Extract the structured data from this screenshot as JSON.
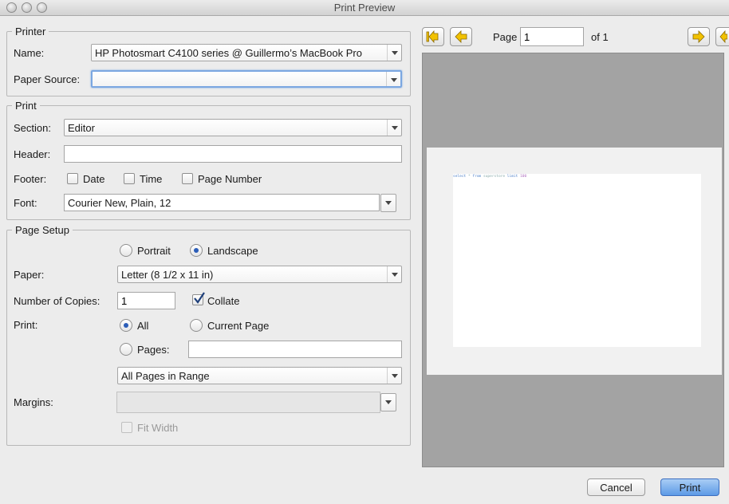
{
  "window": {
    "title": "Print Preview"
  },
  "printer": {
    "legend": "Printer",
    "name_label": "Name:",
    "name_value": "HP Photosmart C4100 series @ Guillermo’s MacBook Pro",
    "source_label": "Paper Source:",
    "source_value": ""
  },
  "print": {
    "legend": "Print",
    "section_label": "Section:",
    "section_value": "Editor",
    "header_label": "Header:",
    "header_value": "",
    "footer_label": "Footer:",
    "footer_date": "Date",
    "footer_time": "Time",
    "footer_page_number": "Page Number",
    "font_label": "Font:",
    "font_value": "Courier New, Plain, 12"
  },
  "page_setup": {
    "legend": "Page Setup",
    "portrait": "Portrait",
    "landscape": "Landscape",
    "orientation_selected": "Landscape",
    "paper_label": "Paper:",
    "paper_value": "Letter (8 1/2 x 11 in)",
    "copies_label": "Number of Copies:",
    "copies_value": "1",
    "collate": "Collate",
    "collate_checked": true,
    "print_label": "Print:",
    "all": "All",
    "current_page": "Current Page",
    "pages": "Pages:",
    "pages_value": "",
    "range_value": "All Pages in Range",
    "margins_label": "Margins:",
    "margins_value": "",
    "fit_width": "Fit Width"
  },
  "preview": {
    "page_label": "Page",
    "page_value": "1",
    "of_label": "of 1",
    "code": {
      "select": "select",
      "star": "*",
      "from": "from",
      "table": "superstore",
      "limit": "limit",
      "n": "100"
    }
  },
  "footer": {
    "cancel": "Cancel",
    "print": "Print"
  },
  "colors": {
    "accent": "#5c9ae6",
    "preview_bg": "#a3a3a3"
  },
  "icons": [
    "first-page-icon",
    "prev-page-icon",
    "next-page-icon",
    "last-page-icon"
  ]
}
